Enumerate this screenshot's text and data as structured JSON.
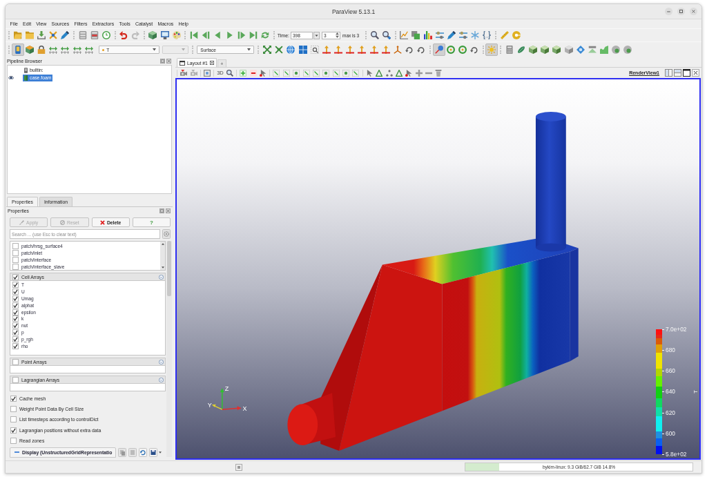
{
  "window": {
    "title": "ParaView 5.13.1"
  },
  "menu": [
    "File",
    "Edit",
    "View",
    "Sources",
    "Filters",
    "Extractors",
    "Tools",
    "Catalyst",
    "Macros",
    "Help"
  ],
  "main_toolbar": {
    "time_label": "Time:",
    "time_value": "398",
    "time_index": "3",
    "time_max": "max is 3"
  },
  "second_toolbar": {
    "buttons": [
      {
        "on": true
      },
      {
        "on": false
      },
      {
        "on": false
      },
      {
        "on": false
      },
      {
        "on": false
      },
      {
        "on": false
      },
      {
        "on": false
      },
      {
        "on": false
      },
      {
        "on": false
      },
      {
        "on": false
      },
      {
        "on": false
      },
      {
        "on": false
      },
      {
        "on": false
      },
      {
        "on": false
      },
      {
        "on": false
      },
      {
        "on": false
      },
      {
        "on": false
      },
      {
        "on": false
      },
      {
        "on": false
      },
      {
        "on": false
      },
      {
        "on": false
      },
      {
        "on": true
      },
      {
        "on": false
      },
      {
        "on": false
      },
      {
        "on": false
      },
      {
        "on": true
      },
      {
        "on": false
      },
      {
        "on": false
      },
      {
        "on": false
      },
      {
        "on": false
      },
      {
        "on": false
      },
      {
        "on": false
      },
      {
        "on": false
      },
      {
        "on": false
      },
      {
        "on": false
      },
      {
        "on": false
      },
      {
        "on": false
      }
    ],
    "array_combo": {
      "value": "T"
    },
    "component_combo": {
      "disabled": true
    },
    "representation_combo": {
      "value": "Surface"
    }
  },
  "pipeline_browser": {
    "title": "Pipeline Browser",
    "items": [
      {
        "label": "builtin:",
        "selected": false,
        "visible": false,
        "children": [
          {
            "label": "case.foam",
            "selected": true,
            "visible": true
          }
        ]
      }
    ]
  },
  "panel_tabs": [
    {
      "label": "Properties",
      "selected": true
    },
    {
      "label": "Information",
      "selected": false
    }
  ],
  "properties": {
    "title": "Properties",
    "buttons": [
      {
        "label": "Apply",
        "disabled": true
      },
      {
        "label": "Reset",
        "disabled": true
      },
      {
        "label": "Delete",
        "disabled": false
      },
      {
        "label": "?",
        "disabled": false
      }
    ],
    "search": {
      "placeholder": "Search ... (use Esc to clear text)"
    },
    "patches": [
      {
        "label": "patch/hrsg_surface4",
        "checked": false
      },
      {
        "label": "patch/inlet",
        "checked": false
      },
      {
        "label": "patch/interface",
        "checked": false
      },
      {
        "label": "patch/interface_slave",
        "checked": false
      }
    ],
    "array_groups": [
      {
        "title": "Cell Arrays",
        "checked": true,
        "items": [
          {
            "label": "T",
            "checked": true
          },
          {
            "label": "U",
            "checked": true
          },
          {
            "label": "Umag",
            "checked": true
          },
          {
            "label": "alphat",
            "checked": true
          },
          {
            "label": "epsilon",
            "checked": true
          },
          {
            "label": "k",
            "checked": true
          },
          {
            "label": "nut",
            "checked": true
          },
          {
            "label": "p",
            "checked": true
          },
          {
            "label": "p_rgh",
            "checked": true
          },
          {
            "label": "rho",
            "checked": true
          }
        ]
      },
      {
        "title": "Point Arrays",
        "checked": false
      },
      {
        "title": "Lagrangian Arrays",
        "checked": false
      }
    ],
    "options": [
      {
        "label": "Cache mesh",
        "checked": true
      },
      {
        "label": "Weight Point Data By Cell Size",
        "checked": false
      },
      {
        "label": "List timesteps according to controlDict",
        "checked": false
      },
      {
        "label": "Lagrangian positions without extra data",
        "checked": true
      },
      {
        "label": "Read zones",
        "checked": false
      }
    ],
    "display_section": {
      "title": "Display (UnstructuredGridRepresentatio"
    }
  },
  "layout": {
    "tabs": [
      {
        "label": "Layout #1",
        "selected": true
      }
    ],
    "new_tab": "+",
    "mode_button": "3D",
    "view_name": "RenderView1"
  },
  "render_view": {
    "axis_labels": [
      "Z",
      "Y",
      "X"
    ],
    "color_legend": {
      "title": "T",
      "labels": [
        "7.0e+02",
        "680",
        "660",
        "640",
        "620",
        "600",
        "5.8e+02"
      ]
    }
  },
  "status_bar": {
    "memory": {
      "label": "bykim-linux: 9.3 GiB/62.7 GiB 14.8%",
      "level": 0.148
    }
  }
}
